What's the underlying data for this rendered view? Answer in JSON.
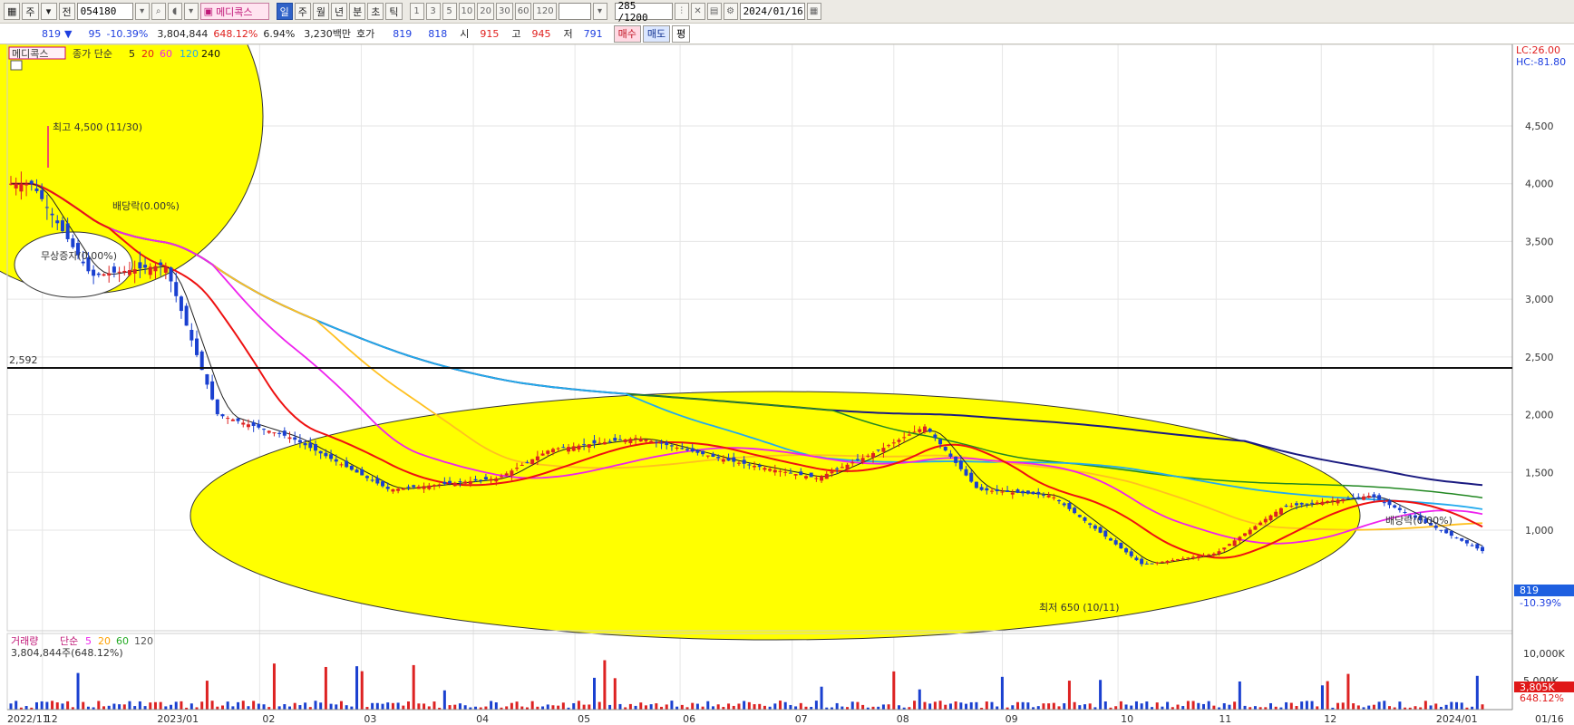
{
  "toolbar": {
    "stock_code": "054180",
    "stock_name": "메디콕스",
    "period_tabs": [
      "일",
      "주",
      "월",
      "년",
      "분",
      "초",
      "틱"
    ],
    "interval_buttons": [
      "1",
      "3",
      "5",
      "10",
      "20",
      "30",
      "60",
      "120"
    ],
    "count_display": "285 /1200",
    "date": "2024/01/16",
    "btn_ju": "주",
    "btn_jeon": "전"
  },
  "quote": {
    "current": "819",
    "change": "95",
    "change_pct": "-10.39%",
    "volume": "3,804,844",
    "volume_ratio": "648.12%",
    "turnover": "6.94%",
    "amount": "3,230백만",
    "hoga_label": "호가",
    "ask": "819",
    "bid": "818",
    "open_label": "시",
    "open": "915",
    "high_label": "고",
    "high": "945",
    "low_label": "저",
    "low": "791",
    "buy_label": "매수",
    "sell_label": "매도",
    "eval_label": "평"
  },
  "price_panel": {
    "legend_name": "메디콕스",
    "legend_type": "종가 단순",
    "ma_periods": [
      "5",
      "20",
      "60",
      "120",
      "240"
    ],
    "lc": "LC:26.00",
    "hc": "HC:-81.80",
    "y_ticks": [
      "4,500",
      "4,000",
      "3,500",
      "3,000",
      "2,500",
      "2,000",
      "1,500",
      "1,000"
    ],
    "hline_label": "2,592",
    "current_tag": "819",
    "current_pct": "-10.39%",
    "ann_high": "최고 4,500 (11/30)",
    "ann_div1": "배당락(0.00%)",
    "ann_bonus": "무상증자(0.00%)",
    "ann_low": "최저 650 (10/11)",
    "ann_div2": "배당락(0.00%)"
  },
  "volume_panel": {
    "legend_name": "거래량",
    "legend_type": "단순",
    "ma_periods": [
      "5",
      "20",
      "60",
      "120"
    ],
    "volume_text": "3,804,844주(648.12%)",
    "y_ticks": [
      "10,000K",
      "5,000K"
    ],
    "current_tag": "3,805K",
    "current_pct": "648.12%"
  },
  "x_axis": [
    "2022/11",
    "12",
    "2023/01",
    "02",
    "03",
    "04",
    "05",
    "06",
    "07",
    "08",
    "09",
    "10",
    "11",
    "12",
    "2024/01",
    "01/16"
  ],
  "colors": {
    "ma5": "#222222",
    "ma20": "#ee1111",
    "ma60": "#ee22ee",
    "ma120": "#ffc020",
    "ma240": "#22aaee",
    "ma_green": "#228822",
    "ma_navy": "#1a1a80",
    "up": "#dd2222",
    "down": "#1a40d0",
    "highlight": "#ffff00"
  },
  "chart_data": {
    "type": "candlestick",
    "last_price": 819,
    "low": 650,
    "high": 4500,
    "hline": 2592,
    "approx_close_path": [
      [
        "2022-11-28",
        4000
      ],
      [
        "2022-12-15",
        3200
      ],
      [
        "2023-01-05",
        3300
      ],
      [
        "2023-01-20",
        2000
      ],
      [
        "2023-02-10",
        1800
      ],
      [
        "2023-03-10",
        1350
      ],
      [
        "2023-04-10",
        1450
      ],
      [
        "2023-04-25",
        1700
      ],
      [
        "2023-05-20",
        1800
      ],
      [
        "2023-06-15",
        1600
      ],
      [
        "2023-07-10",
        1450
      ],
      [
        "2023-07-25",
        1650
      ],
      [
        "2023-08-10",
        1900
      ],
      [
        "2023-08-25",
        1350
      ],
      [
        "2023-09-15",
        1300
      ],
      [
        "2023-10-11",
        700
      ],
      [
        "2023-11-01",
        800
      ],
      [
        "2023-11-20",
        1200
      ],
      [
        "2023-12-15",
        1300
      ],
      [
        "2024-01-16",
        819
      ]
    ]
  }
}
